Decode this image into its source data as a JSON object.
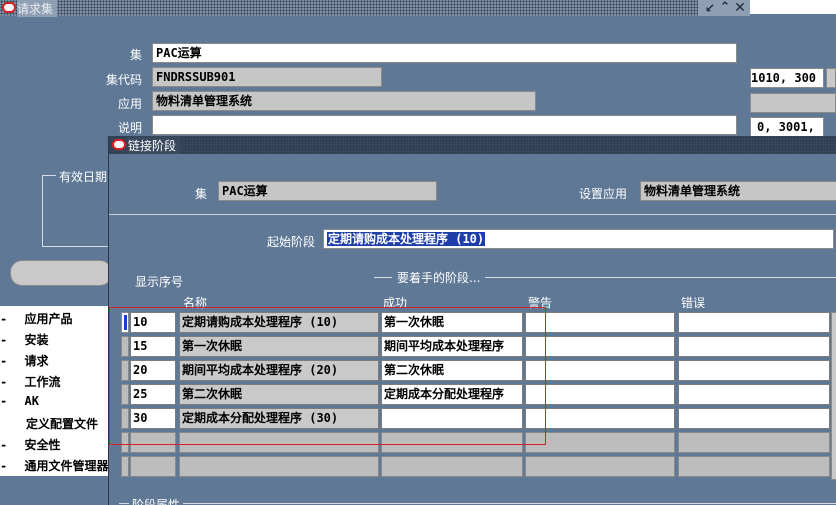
{
  "main_window": {
    "title": "请求集",
    "labels": {
      "set": "集",
      "set_code": "集代码",
      "application": "应用",
      "description": "说明",
      "effective_dates": "有效日期"
    },
    "set_value": "PAC运算",
    "set_code_value": "FNDRSSUB901",
    "application_value": "物料清单管理系统",
    "right_text_1": "1010, 300",
    "right_text_2": "0, 3001,"
  },
  "navigator": {
    "items": [
      {
        "label": "应用产品",
        "prefix": "-"
      },
      {
        "label": "安装",
        "prefix": "-"
      },
      {
        "label": "请求",
        "prefix": "-"
      },
      {
        "label": "工作流",
        "prefix": "-"
      },
      {
        "label": "AK",
        "prefix": "-"
      },
      {
        "label": "定义配置文件",
        "prefix": ""
      },
      {
        "label": "安全性",
        "prefix": "-"
      },
      {
        "label": "通用文件管理器",
        "prefix": "-"
      }
    ]
  },
  "link_dialog": {
    "title": "链接阶段",
    "labels": {
      "set": "集",
      "set_app": "设置应用",
      "start_stage": "起始阶段",
      "display_seq": "显示序号",
      "stages_group": "要着手的阶段...",
      "stage_attrs": "阶段属性"
    },
    "set_value": "PAC运算",
    "set_app_value": "物料清单管理系统",
    "start_stage_value": "定期请购成本处理程序 (10)",
    "columns": {
      "name": "名称",
      "success": "成功",
      "warning": "警告",
      "error": "错误"
    },
    "rows": [
      {
        "seq": "10",
        "name": "定期请购成本处理程序 (10)",
        "success": "第一次休眠",
        "warning": "",
        "error": ""
      },
      {
        "seq": "15",
        "name": "第一次休眠",
        "success": "期间平均成本处理程序",
        "warning": "",
        "error": ""
      },
      {
        "seq": "20",
        "name": "期间平均成本处理程序 (20)",
        "success": "第二次休眠",
        "warning": "",
        "error": ""
      },
      {
        "seq": "25",
        "name": "第二次休眠",
        "success": "定期成本分配处理程序",
        "warning": "",
        "error": ""
      },
      {
        "seq": "30",
        "name": "定期成本分配处理程序 (30)",
        "success": "",
        "warning": "",
        "error": ""
      }
    ]
  },
  "colors": {
    "background": "#5f7896",
    "highlight": "#d8202c",
    "selection": "#1d3da8"
  },
  "icons": [
    "oracle-icon",
    "minimize-icon",
    "restore-icon",
    "close-icon"
  ]
}
